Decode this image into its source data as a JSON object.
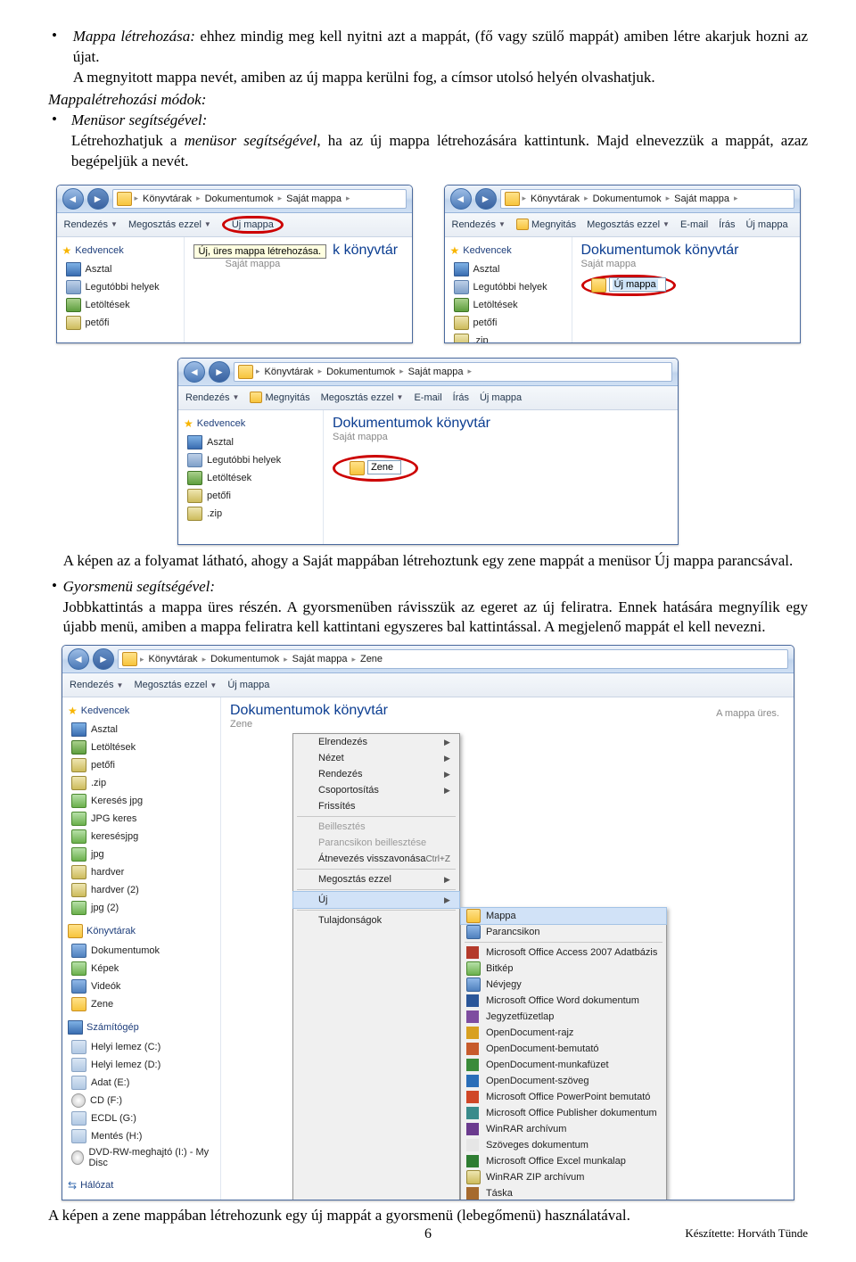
{
  "text": {
    "p1_lead": "Mappa létrehozása:",
    "p1_rest": " ehhez mindig meg kell nyitni azt a mappát, (fő vagy szülő mappát) amiben létre akarjuk hozni az újat.",
    "p2": "A megnyitott mappa nevét, amiben az új mappa kerülni fog, a címsor utolsó helyén olvashatjuk.",
    "p3_lead": "Mappalétrehozási módok:",
    "b1_head": "Menüsor segítségével:",
    "b1_body_a": "Létrehozhatjuk a ",
    "b1_body_i": "menüsor segítségével",
    "b1_body_b": ", ha az új mappa létrehozására kattintunk. Majd elnevezzük a mappát, azaz begépeljük a nevét.",
    "caption1": "A képen az a folyamat látható, ahogy a Saját mappában létrehoztunk egy zene mappát a menüsor Új mappa parancsával.",
    "b2_head": "Gyorsmenü segítségével:",
    "b2_body": "Jobbkattintás a mappa üres részén. A gyorsmenüben rávisszük az egeret az új feliratra. Ennek hatására megnyílik egy újabb menü, amiben a mappa feliratra kell kattintani egyszeres bal kattintással. A megjelenő mappát el kell nevezni.",
    "caption2": "A képen a zene mappában létrehozunk egy új mappát a gyorsmenü (lebegőmenü) használatával.",
    "page_num": "6",
    "credit": "Készítette: Horváth Tünde"
  },
  "breadcrumb": {
    "c1": "Könyvtárak",
    "c2": "Dokumentumok",
    "c3": "Saját mappa",
    "c4": "Zene"
  },
  "toolbar": {
    "rendezes": "Rendezés",
    "megosztas_ezzel": "Megosztás ezzel",
    "megnyitas": "Megnyitás",
    "email": "E-mail",
    "iras": "Írás",
    "uj_mappa": "Új mappa"
  },
  "sidebar": {
    "kedvencek": "Kedvencek",
    "asztal": "Asztal",
    "legutobbi": "Legutóbbi helyek",
    "letoltesek": "Letöltések",
    "petofi": "petőfi",
    "zip": ".zip",
    "kereses_jpg": "Keresés jpg",
    "jpg_keres": "JPG keres",
    "keresesjpg": "keresésjpg",
    "jpg": "jpg",
    "hardver": "hardver",
    "hardver2": "hardver (2)",
    "jpg2": "jpg (2)",
    "konyvtarak": "Könyvtárak",
    "dokumentumok": "Dokumentumok",
    "kepek": "Képek",
    "videok": "Videók",
    "zene": "Zene",
    "szamitogep": "Számítógép",
    "helyiC": "Helyi lemez (C:)",
    "helyiD": "Helyi lemez (D:)",
    "adatE": "Adat (E:)",
    "cdF": "CD (F:)",
    "ecdlG": "ECDL (G:)",
    "mentesH": "Mentés (H:)",
    "dvdI": "DVD-RW-meghajtó (I:) - My Disc",
    "halozat": "Hálózat"
  },
  "content": {
    "lib_title_short": "k könyvtár",
    "lib_title_full": "Dokumentumok könyvtár",
    "lib_sub": "Saját mappa",
    "lib_sub_zene": "Zene",
    "tooltip": "Új, üres mappa létrehozása.",
    "newfolder": "Új mappa",
    "zene_input": "Zene",
    "empty": "A mappa üres."
  },
  "ctx": {
    "elrendezes": "Elrendezés",
    "nezet": "Nézet",
    "rendezes": "Rendezés",
    "csoportositas": "Csoportosítás",
    "frissites": "Frissítés",
    "beillesztes": "Beillesztés",
    "parancs_beill": "Parancsikon beillesztése",
    "atnev_vissza": "Átnevezés visszavonása",
    "ctrlz": "Ctrl+Z",
    "megosztas": "Megosztás ezzel",
    "uj": "Új",
    "tulajd": "Tulajdonságok",
    "s_mappa": "Mappa",
    "s_parancsikon": "Parancsikon",
    "s_access": "Microsoft Office Access 2007 Adatbázis",
    "s_bitkep": "Bitkép",
    "s_nevjegy": "Névjegy",
    "s_word": "Microsoft Office Word dokumentum",
    "s_jegyz": "Jegyzetfüzetlap",
    "s_odraj": "OpenDocument-rajz",
    "s_obem": "OpenDocument-bemutató",
    "s_omunk": "OpenDocument-munkafüzet",
    "s_oszov": "OpenDocument-szöveg",
    "s_ppt": "Microsoft Office PowerPoint bemutató",
    "s_pub": "Microsoft Office Publisher dokumentum",
    "s_rar": "WinRAR archívum",
    "s_txt": "Szöveges dokumentum",
    "s_excel": "Microsoft Office Excel munkalap",
    "s_zip": "WinRAR ZIP archívum",
    "s_taska": "Táska"
  }
}
